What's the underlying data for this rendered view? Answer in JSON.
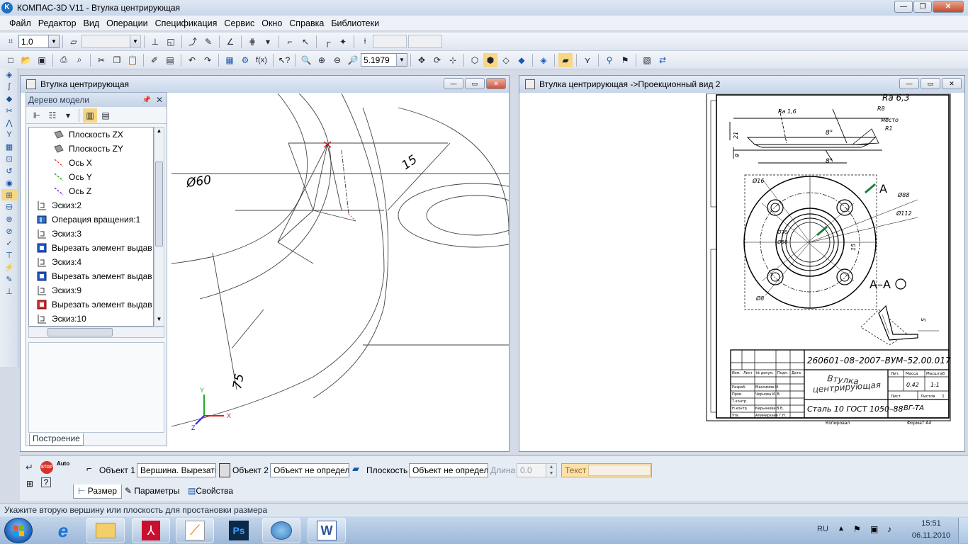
{
  "app": {
    "title": "КОМПАС-3D V11 - Втулка центрирующая",
    "logo_letter": "K",
    "window_buttons": [
      "—",
      "❐",
      "✕"
    ]
  },
  "menu": [
    "Файл",
    "Редактор",
    "Вид",
    "Операции",
    "Спецификация",
    "Сервис",
    "Окно",
    "Справка",
    "Библиотеки"
  ],
  "toolbar1": {
    "step_value": "1.0",
    "layer_value": ""
  },
  "toolbar2": {
    "zoom_value": "5.1979",
    "fx_label": "f(x)"
  },
  "doc1": {
    "title": "Втулка центрирующая",
    "dimensions": [
      "Ø60",
      "15",
      "75"
    ],
    "axes": [
      "Y",
      "X",
      "Z"
    ]
  },
  "tree": {
    "header": "Дерево модели",
    "tab": "Построение",
    "items": [
      {
        "label": "Плоскость ZX",
        "icon": "plane",
        "indent": 2
      },
      {
        "label": "Плоскость ZY",
        "icon": "plane",
        "indent": 2
      },
      {
        "label": "Ось X",
        "icon": "axis-x",
        "indent": 2
      },
      {
        "label": "Ось Y",
        "icon": "axis-y",
        "indent": 2
      },
      {
        "label": "Ось Z",
        "icon": "axis-z",
        "indent": 2
      },
      {
        "label": "Эскиз:2",
        "icon": "sketch",
        "indent": 1
      },
      {
        "label": "Операция вращения:1",
        "icon": "rotate-op",
        "indent": 1
      },
      {
        "label": "Эскиз:3",
        "icon": "sketch",
        "indent": 1
      },
      {
        "label": "Вырезать элемент выдав",
        "icon": "cut-op",
        "indent": 1
      },
      {
        "label": "Эскиз:4",
        "icon": "sketch",
        "indent": 1
      },
      {
        "label": "Вырезать элемент выдав",
        "icon": "cut-op",
        "indent": 1
      },
      {
        "label": "Эскиз:9",
        "icon": "sketch",
        "indent": 1
      },
      {
        "label": "Вырезать элемент выдав",
        "icon": "cut-op-red",
        "indent": 1
      },
      {
        "label": "Эскиз:10",
        "icon": "sketch",
        "indent": 1
      }
    ]
  },
  "doc2": {
    "title": "Втулка центрирующая ->Проекционный вид 2",
    "roughness": "Ra 6,3",
    "labels": {
      "ra16": "Ra 1,6",
      "r8": "R8",
      "mesto": "место",
      "r1": "R1",
      "deg8a": "8°",
      "deg8b": "8°",
      "dim21": "21",
      "dim9": "9",
      "phi16": "Ø16",
      "phi88": "Ø88",
      "phi112": "Ø112",
      "phi70": "Ø70",
      "phi60": "Ø60",
      "dim8": "Ø8",
      "dim15": "15",
      "dim5": "5",
      "sectA": "А",
      "sectAA": "А–А"
    },
    "stamp": {
      "designation": "260601–08–2007–ВУМ–52.00.017",
      "name1": "Втулка",
      "name2": "центрирующая",
      "material": "Сталь 10  ГОСТ 1050–88",
      "org": "ВГ-ТА",
      "mass": "0.42",
      "scale": "1:1",
      "lit": "Лит.",
      "massa": "Масса",
      "masshtab": "Масштаб",
      "list": "Лист",
      "listov": "Листов",
      "listov_val": "1",
      "kopiroval": "Копировал",
      "format": "Формат  А4",
      "razrab": "Разраб.",
      "prov": "Пров.",
      "tkontr": "Т.контр.",
      "nkontr": "Н.контр.",
      "utv": "Утв.",
      "izm": "Изм.",
      "listc": "Лист",
      "ndokum": "№ докум.",
      "podp": "Подп.",
      "data": "Дата",
      "razrab_name": "Максимов М.",
      "prov_name": "Чернова И. В.",
      "nkontr_name": "Кирьянова В.В.",
      "utv_name": "Алимирзаев Г.Н."
    }
  },
  "propbar": {
    "obj1_label": "Объект 1",
    "obj1_value": "Вершина. Вырезать",
    "obj2_label": "Объект 2",
    "obj2_value": "Объект не определен",
    "plane_label": "Плоскость",
    "plane_value": "Объект не определен",
    "length_label": "Длина",
    "length_value": "0.0",
    "text_label": "Текст",
    "stop": "STOP",
    "auto": "Auto",
    "tabs": [
      "Размер",
      "Параметры",
      "Свойства"
    ]
  },
  "status": "Укажите вторую вершину или плоскость для простановки размера",
  "taskbar": {
    "lang": "RU",
    "time": "15:51",
    "date": "06.11.2010",
    "ps_label": "Ps",
    "word_label": "W"
  }
}
